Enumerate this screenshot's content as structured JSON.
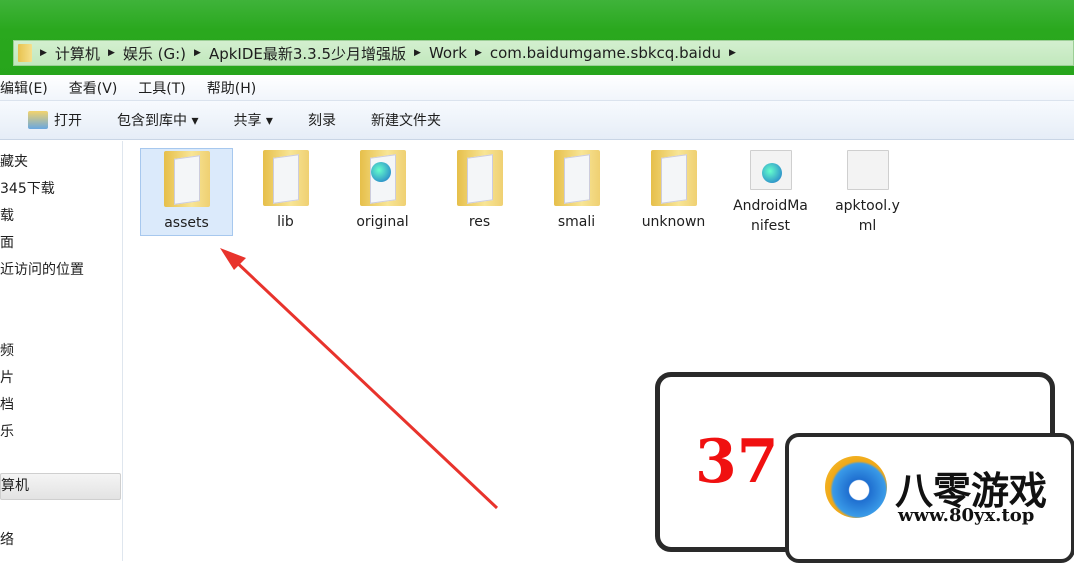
{
  "address_bar": {
    "segments": [
      "计算机",
      "娱乐 (G:)",
      "ApkIDE最新3.3.5少月增强版",
      "Work",
      "com.baidumgame.sbkcq.baidu"
    ]
  },
  "menu": [
    "编辑(E)",
    "查看(V)",
    "工具(T)",
    "帮助(H)"
  ],
  "toolbar": {
    "open": "打开",
    "include_library": "包含到库中 ▾",
    "share": "共享 ▾",
    "burn": "刻录",
    "new_folder": "新建文件夹"
  },
  "sidebar": [
    "藏夹",
    "345下载",
    "载",
    "面",
    "近访问的位置",
    "",
    "",
    "频",
    "片",
    "档",
    "乐",
    "",
    "算机",
    "",
    "络"
  ],
  "files": [
    {
      "name": "assets",
      "type": "folder",
      "selected": true
    },
    {
      "name": "lib",
      "type": "folder"
    },
    {
      "name": "original",
      "type": "folder-web"
    },
    {
      "name": "res",
      "type": "folder"
    },
    {
      "name": "smali",
      "type": "folder"
    },
    {
      "name": "unknown",
      "type": "folder"
    },
    {
      "name": "AndroidManifest",
      "type": "xml"
    },
    {
      "name": "apktool.yml",
      "type": "file"
    }
  ],
  "watermark": {
    "name": "八零游戏",
    "url": "www.80yx.top",
    "behind": "37"
  },
  "colors": {
    "titlebar": "#2aa81e",
    "arrow": "#e8332c"
  }
}
